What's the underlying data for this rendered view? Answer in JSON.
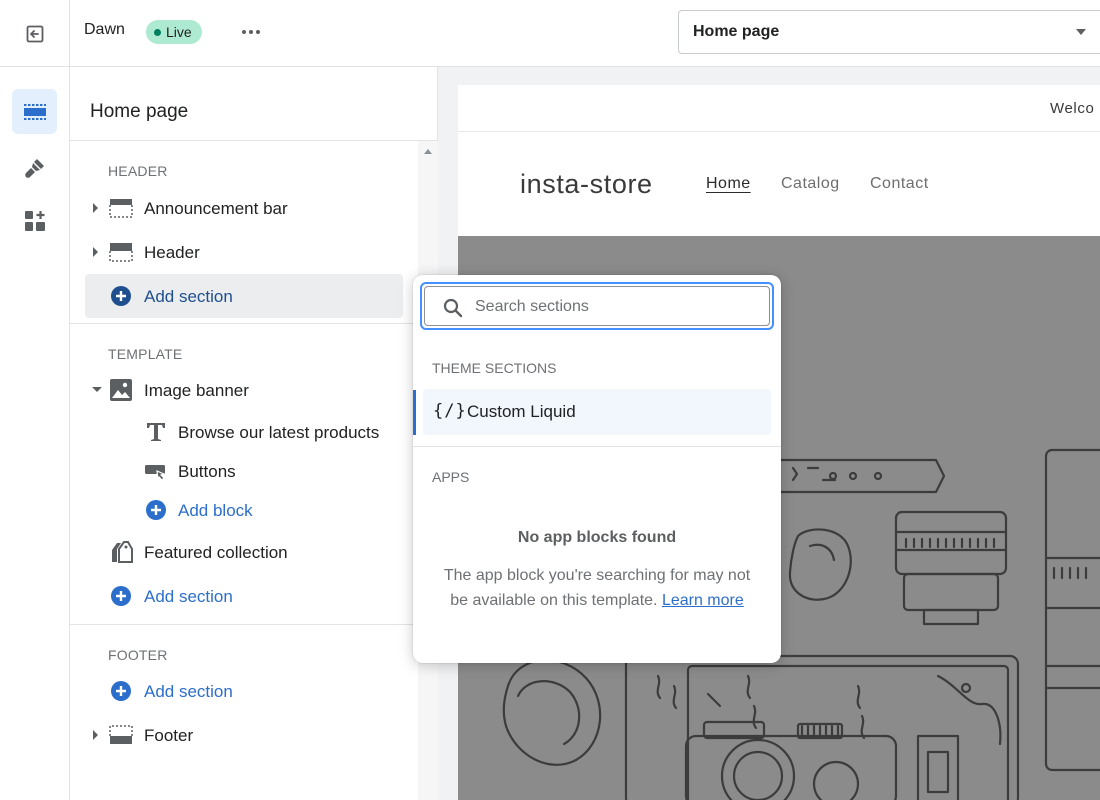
{
  "topbar": {
    "theme_name": "Dawn",
    "status_badge": "Live",
    "page_selector": "Home page"
  },
  "sidebar": {
    "title": "Home page",
    "header_group": {
      "label": "HEADER",
      "items": [
        "Announcement bar",
        "Header"
      ],
      "add_section": "Add section"
    },
    "template_group": {
      "label": "TEMPLATE",
      "image_banner": "Image banner",
      "blocks": [
        "Browse our latest products",
        "Buttons"
      ],
      "add_block": "Add block",
      "featured_collection": "Featured collection",
      "add_section": "Add section"
    },
    "footer_group": {
      "label": "FOOTER",
      "add_section": "Add section",
      "items": [
        "Footer"
      ]
    }
  },
  "preview": {
    "announcement": "Welco",
    "store_name": "insta-store",
    "nav": [
      "Home",
      "Catalog",
      "Contact"
    ]
  },
  "popover": {
    "search_placeholder": "Search sections",
    "theme_sections_label": "THEME SECTIONS",
    "theme_sections": [
      {
        "icon": "{/}",
        "label": "Custom Liquid"
      }
    ],
    "apps_label": "APPS",
    "empty_title": "No app blocks found",
    "empty_body": "The app block you're searching for may not be available on this template.",
    "empty_link": "Learn more"
  },
  "colors": {
    "accent": "#2c6ecb",
    "live_badge": "#aee9d1",
    "banner_gray": "#8b8b8b"
  }
}
